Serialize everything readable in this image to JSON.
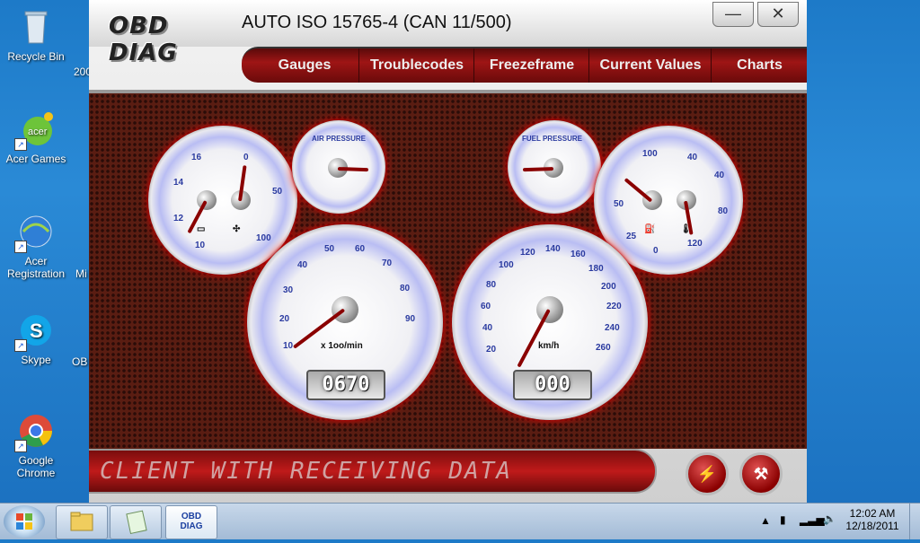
{
  "desktop": {
    "icons": [
      {
        "label": "Recycle Bin"
      },
      {
        "label": "Acer Games"
      },
      {
        "label": "Acer Registration"
      },
      {
        "label": "Skype"
      },
      {
        "label": "Google Chrome"
      }
    ],
    "partial_labels": [
      "200",
      "Mi",
      "OB"
    ]
  },
  "app": {
    "logo_text": "OBD DIAG",
    "title": "AUTO ISO 15765-4 (CAN 11/500)",
    "min_icon": "minimize-icon",
    "close_icon": "close-icon",
    "min_glyph": "—",
    "close_glyph": "✕",
    "tabs": [
      {
        "label": "Gauges"
      },
      {
        "label": "Troublecodes"
      },
      {
        "label": "Freezeframe"
      },
      {
        "label": "Current Values"
      },
      {
        "label": "Charts"
      }
    ],
    "gauges": {
      "air_pressure_label": "AIR PRESSURE",
      "fuel_pressure_label": "FUEL PRESSURE",
      "rpm_unit": "x 1oo/min",
      "rpm_ticks": [
        "10",
        "20",
        "30",
        "40",
        "50",
        "60",
        "70",
        "80",
        "90"
      ],
      "speed_unit": "km/h",
      "speed_ticks": [
        "20",
        "40",
        "60",
        "80",
        "100",
        "120",
        "140",
        "160",
        "180",
        "200",
        "220",
        "240",
        "260"
      ],
      "left_small_ticks": [
        "16",
        "14",
        "12",
        "10",
        "0",
        "50",
        "100"
      ],
      "right_small_ticks": [
        "100",
        "50",
        "25",
        "0",
        "40",
        "40",
        "80",
        "120"
      ],
      "rpm_display": "0670",
      "speed_display": "000"
    },
    "status_text": "CLIENT WITH RECEIVING DATA",
    "buttons": {
      "left": "⚡",
      "right": "⚒"
    }
  },
  "taskbar": {
    "time": "12:02 AM",
    "date": "12/18/2011",
    "pinned_obd_label": "OBD DIAG"
  },
  "colors": {
    "accent": "#9e1515",
    "desktop": "#1d7ac8",
    "gauge_blue": "#2a3aa0"
  }
}
